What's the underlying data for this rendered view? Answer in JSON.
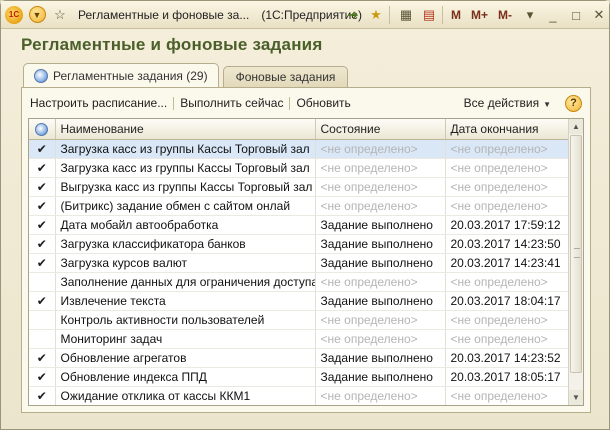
{
  "window": {
    "title": "Регламентные и фоновые за...",
    "app": "(1С:Предприятие)",
    "logo_text": "1С",
    "toolbar_right": [
      "M",
      "M+",
      "M-"
    ]
  },
  "page": {
    "title": "Регламентные и фоновые задания"
  },
  "tabs": [
    {
      "label": "Регламентные задания (29)",
      "active": true
    },
    {
      "label": "Фоновые задания",
      "active": false
    }
  ],
  "toolbar": {
    "schedule_label": "Настроить расписание...",
    "run_now_label": "Выполнить сейчас",
    "refresh_label": "Обновить",
    "all_actions_label": "Все действия",
    "help_label": "?"
  },
  "table": {
    "columns": [
      "",
      "Наименование",
      "Состояние",
      "Дата окончания"
    ],
    "rows": [
      {
        "check": "✔",
        "name": "Загрузка касс из группы Кассы Торговый зал",
        "state": "<не определено>",
        "date": "<не определено>",
        "state_gray": true,
        "date_gray": true,
        "selected": true
      },
      {
        "check": "✔",
        "name": "Загрузка касс из группы Кассы Торговый зал",
        "state": "<не определено>",
        "date": "<не определено>",
        "state_gray": true,
        "date_gray": true
      },
      {
        "check": "✔",
        "name": "Выгрузка касс из группы Кассы Торговый зал",
        "state": "<не определено>",
        "date": "<не определено>",
        "state_gray": true,
        "date_gray": true
      },
      {
        "check": "✔",
        "name": "(Битрикс)  задание обмен с сайтом онлай",
        "state": "<не определено>",
        "date": "<не определено>",
        "state_gray": true,
        "date_gray": true
      },
      {
        "check": "✔",
        "name": "Дата мобайл автообработка",
        "state": "Задание выполнено",
        "date": "20.03.2017 17:59:12"
      },
      {
        "check": "✔",
        "name": "Загрузка классификатора банков",
        "state": "Задание выполнено",
        "date": "20.03.2017 14:23:50"
      },
      {
        "check": "✔",
        "name": "Загрузка курсов валют",
        "state": "Задание выполнено",
        "date": "20.03.2017 14:23:41"
      },
      {
        "check": "",
        "name": "Заполнение данных для ограничения доступа",
        "state": "<не определено>",
        "date": "<не определено>",
        "state_gray": true,
        "date_gray": true
      },
      {
        "check": "✔",
        "name": "Извлечение текста",
        "state": "Задание выполнено",
        "date": "20.03.2017 18:04:17"
      },
      {
        "check": "",
        "name": "Контроль активности пользователей",
        "state": "<не определено>",
        "date": "<не определено>",
        "state_gray": true,
        "date_gray": true
      },
      {
        "check": "",
        "name": "Мониторинг задач",
        "state": "<не определено>",
        "date": "<не определено>",
        "state_gray": true,
        "date_gray": true
      },
      {
        "check": "✔",
        "name": "Обновление агрегатов",
        "state": "Задание выполнено",
        "date": "20.03.2017 14:23:52"
      },
      {
        "check": "✔",
        "name": "Обновление индекса ППД",
        "state": "Задание выполнено",
        "date": "20.03.2017 18:05:17"
      },
      {
        "check": "✔",
        "name": "Ожидание отклика от кассы ККМ1",
        "state": "<не определено>",
        "date": "<не определено>",
        "state_gray": true,
        "date_gray": true
      }
    ]
  },
  "colors": {
    "title_green": "#4b5f2a",
    "selected_row": "#d9e7f7",
    "undefined_gray": "#b4b4b4"
  }
}
